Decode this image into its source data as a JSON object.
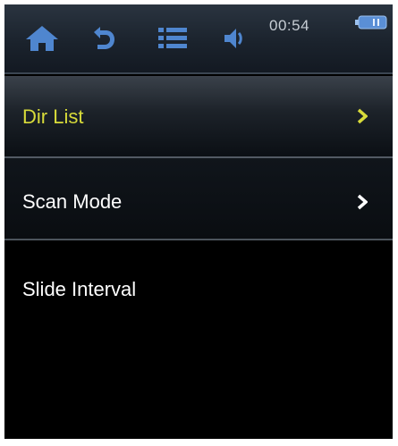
{
  "status_bar": {
    "time": "00:54",
    "icons": [
      "home-icon",
      "back-icon",
      "list-icon",
      "volume-icon",
      "battery-icon"
    ],
    "icon_color": "#4f86cf"
  },
  "menu": {
    "items": [
      {
        "label": "Dir List",
        "selected": true,
        "has_submenu": true
      },
      {
        "label": "Scan Mode",
        "selected": false,
        "has_submenu": true
      },
      {
        "label": "Slide Interval",
        "selected": false,
        "has_submenu": false
      }
    ],
    "selected_color": "#d8db3a",
    "text_color": "#ffffff"
  }
}
